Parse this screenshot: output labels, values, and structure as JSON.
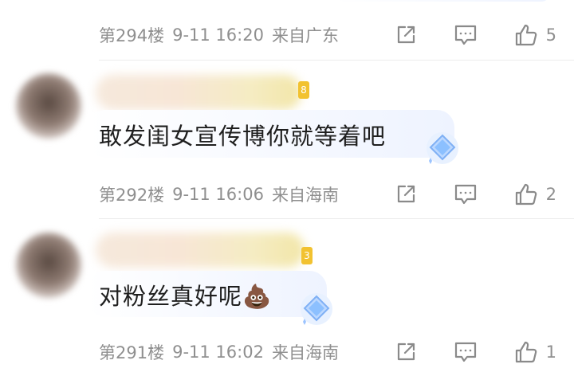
{
  "comments": [
    {
      "floor": "第294楼",
      "time": "9-11 16:20",
      "location": "来自广东",
      "likes": "5",
      "text": ""
    },
    {
      "floor": "第292楼",
      "time": "9-11 16:06",
      "location": "来自海南",
      "likes": "2",
      "text": "敢发闺女宣传博你就等着吧"
    },
    {
      "floor": "第291楼",
      "time": "9-11 16:02",
      "location": "来自海南",
      "likes": "1",
      "text": "对粉丝真好呢",
      "emoji": "💩"
    }
  ],
  "icons": [
    "share-icon",
    "comment-icon",
    "thumbs-up-icon",
    "diamond-icon"
  ],
  "colors": {
    "meta_text": "#8f8f8f",
    "comment_text": "#1f1f1f",
    "badge": "#f2c230"
  }
}
